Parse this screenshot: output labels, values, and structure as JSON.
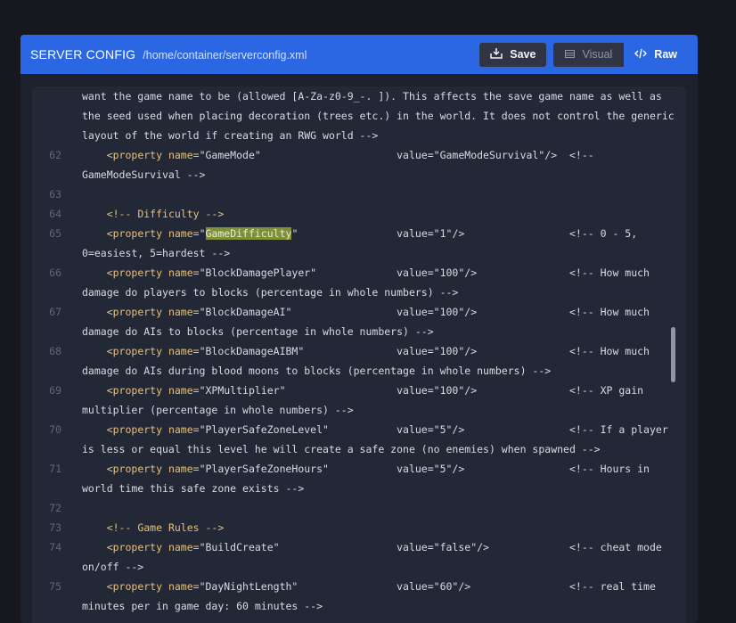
{
  "header": {
    "title": "SERVER CONFIG",
    "path": "/home/container/serverconfig.xml",
    "save_label": "Save",
    "visual_label": "Visual",
    "raw_label": "Raw"
  },
  "editor": {
    "lines": [
      {
        "num": "",
        "text": "want the game name to be (allowed [A-Za-z0-9_-. ]). This affects the save game name as well as"
      },
      {
        "num": "",
        "text": "the seed used when placing decoration (trees etc.) in the world. It does not control the generic"
      },
      {
        "num": "",
        "text": "layout of the world if creating an RWG world -->"
      },
      {
        "num": "62",
        "text": "    <property name=\"GameMode\"                      value=\"GameModeSurvival\"/>  <!--"
      },
      {
        "num": "",
        "text": "GameModeSurvival -->"
      },
      {
        "num": "63",
        "text": ""
      },
      {
        "num": "64",
        "text": "    <!-- Difficulty -->"
      },
      {
        "num": "65",
        "pre": "    <property name=\"",
        "hl": "GameDifficulty",
        "post": "\"                value=\"1\"/>                 <!-- 0 - 5,"
      },
      {
        "num": "",
        "text": "0=easiest, 5=hardest -->"
      },
      {
        "num": "66",
        "text": "    <property name=\"BlockDamagePlayer\"             value=\"100\"/>               <!-- How much"
      },
      {
        "num": "",
        "text": "damage do players to blocks (percentage in whole numbers) -->"
      },
      {
        "num": "67",
        "text": "    <property name=\"BlockDamageAI\"                 value=\"100\"/>               <!-- How much"
      },
      {
        "num": "",
        "text": "damage do AIs to blocks (percentage in whole numbers) -->"
      },
      {
        "num": "68",
        "text": "    <property name=\"BlockDamageAIBM\"               value=\"100\"/>               <!-- How much"
      },
      {
        "num": "",
        "text": "damage do AIs during blood moons to blocks (percentage in whole numbers) -->"
      },
      {
        "num": "69",
        "text": "    <property name=\"XPMultiplier\"                  value=\"100\"/>               <!-- XP gain"
      },
      {
        "num": "",
        "text": "multiplier (percentage in whole numbers) -->"
      },
      {
        "num": "70",
        "text": "    <property name=\"PlayerSafeZoneLevel\"           value=\"5\"/>                 <!-- If a player"
      },
      {
        "num": "",
        "text": "is less or equal this level he will create a safe zone (no enemies) when spawned -->"
      },
      {
        "num": "71",
        "text": "    <property name=\"PlayerSafeZoneHours\"           value=\"5\"/>                 <!-- Hours in"
      },
      {
        "num": "",
        "text": "world time this safe zone exists -->"
      },
      {
        "num": "72",
        "text": ""
      },
      {
        "num": "73",
        "text": "    <!-- Game Rules -->"
      },
      {
        "num": "74",
        "text": "    <property name=\"BuildCreate\"                   value=\"false\"/>             <!-- cheat mode"
      },
      {
        "num": "",
        "text": "on/off -->"
      },
      {
        "num": "75",
        "text": "    <property name=\"DayNightLength\"                value=\"60\"/>                <!-- real time"
      },
      {
        "num": "",
        "text": "minutes per in game day: 60 minutes -->"
      }
    ]
  }
}
